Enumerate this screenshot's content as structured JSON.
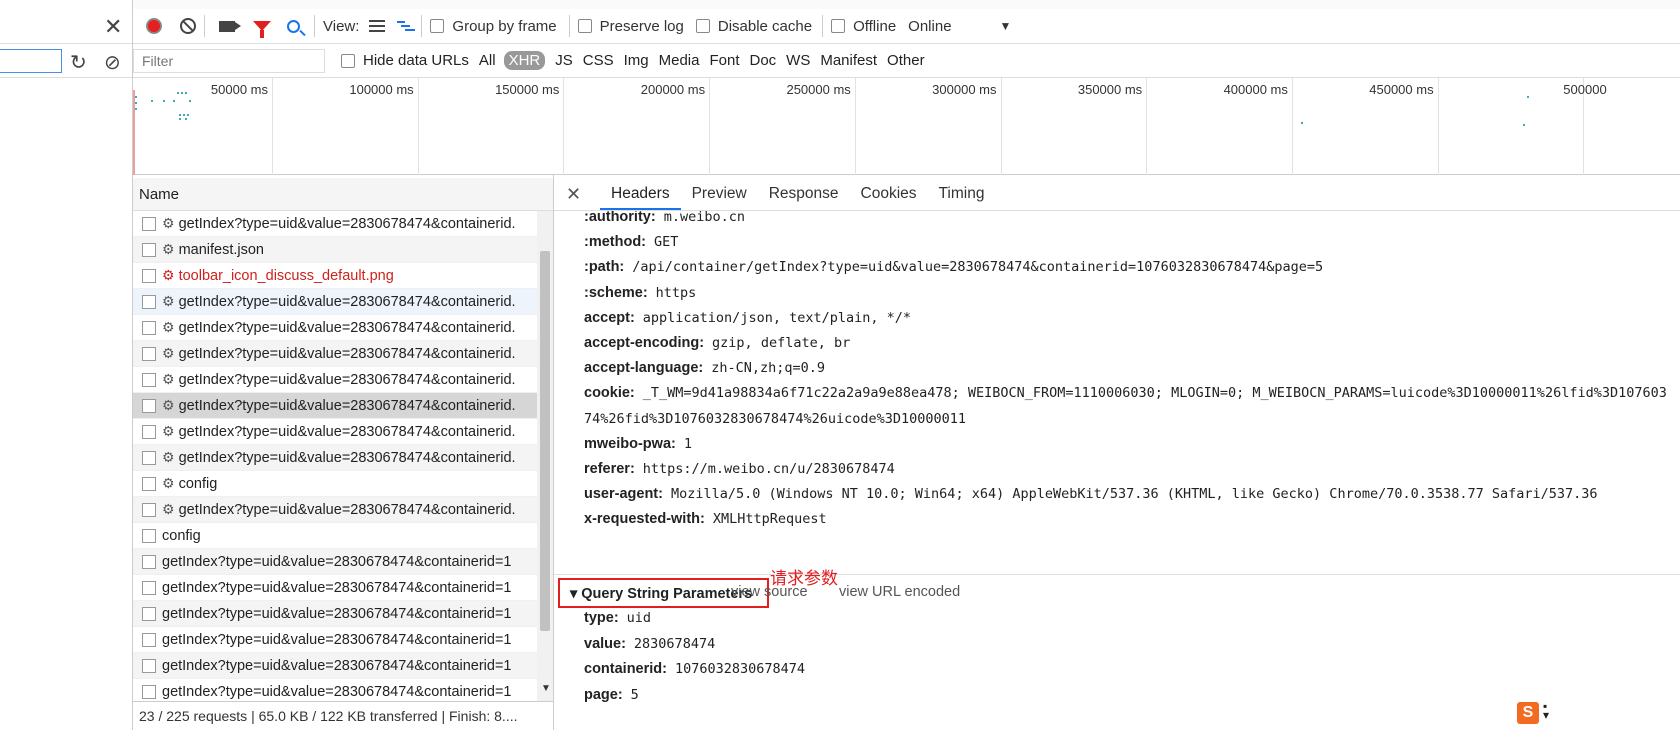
{
  "toolbar": {
    "view_label": "View:",
    "group_by_frame": "Group by frame",
    "preserve_log": "Preserve log",
    "disable_cache": "Disable cache",
    "offline": "Offline",
    "throttle": "Online"
  },
  "filterbar": {
    "placeholder": "Filter",
    "hide_data_urls": "Hide data URLs",
    "types": [
      "All",
      "XHR",
      "JS",
      "CSS",
      "Img",
      "Media",
      "Font",
      "Doc",
      "WS",
      "Manifest",
      "Other"
    ],
    "active_type": "XHR"
  },
  "overview": {
    "ticks": [
      "50000 ms",
      "100000 ms",
      "150000 ms",
      "200000 ms",
      "250000 ms",
      "300000 ms",
      "350000 ms",
      "400000 ms",
      "450000 ms",
      "500000"
    ]
  },
  "requests": {
    "header": "Name",
    "items": [
      {
        "name": "getIndex?type=uid&value=2830678474&containerid.",
        "icon": true,
        "state": "normal"
      },
      {
        "name": "manifest.json",
        "icon": true,
        "state": "alt"
      },
      {
        "name": "toolbar_icon_discuss_default.png",
        "icon": true,
        "state": "error"
      },
      {
        "name": "getIndex?type=uid&value=2830678474&containerid.",
        "icon": true,
        "state": "highlight"
      },
      {
        "name": "getIndex?type=uid&value=2830678474&containerid.",
        "icon": true,
        "state": "normal"
      },
      {
        "name": "getIndex?type=uid&value=2830678474&containerid.",
        "icon": true,
        "state": "alt"
      },
      {
        "name": "getIndex?type=uid&value=2830678474&containerid.",
        "icon": true,
        "state": "normal"
      },
      {
        "name": "getIndex?type=uid&value=2830678474&containerid.",
        "icon": true,
        "state": "selected"
      },
      {
        "name": "getIndex?type=uid&value=2830678474&containerid.",
        "icon": true,
        "state": "normal"
      },
      {
        "name": "getIndex?type=uid&value=2830678474&containerid.",
        "icon": true,
        "state": "alt"
      },
      {
        "name": "config",
        "icon": true,
        "state": "normal"
      },
      {
        "name": "getIndex?type=uid&value=2830678474&containerid.",
        "icon": true,
        "state": "alt"
      },
      {
        "name": "config",
        "icon": false,
        "state": "normal"
      },
      {
        "name": "getIndex?type=uid&value=2830678474&containerid=1",
        "icon": false,
        "state": "alt"
      },
      {
        "name": "getIndex?type=uid&value=2830678474&containerid=1",
        "icon": false,
        "state": "normal"
      },
      {
        "name": "getIndex?type=uid&value=2830678474&containerid=1",
        "icon": false,
        "state": "alt"
      },
      {
        "name": "getIndex?type=uid&value=2830678474&containerid=1",
        "icon": false,
        "state": "normal"
      },
      {
        "name": "getIndex?type=uid&value=2830678474&containerid=1",
        "icon": false,
        "state": "alt"
      },
      {
        "name": "getIndex?type=uid&value=2830678474&containerid=1",
        "icon": false,
        "state": "normal"
      }
    ],
    "status": "23 / 225 requests  |  65.0 KB / 122 KB transferred  |  Finish: 8...."
  },
  "details": {
    "tabs": [
      "Headers",
      "Preview",
      "Response",
      "Cookies",
      "Timing"
    ],
    "active_tab": "Headers",
    "headers": [
      {
        "key": ":authority:",
        "value": "m.weibo.cn"
      },
      {
        "key": ":method:",
        "value": "GET"
      },
      {
        "key": ":path:",
        "value": "/api/container/getIndex?type=uid&value=2830678474&containerid=1076032830678474&page=5"
      },
      {
        "key": ":scheme:",
        "value": "https"
      },
      {
        "key": "accept:",
        "value": "application/json, text/plain, */*"
      },
      {
        "key": "accept-encoding:",
        "value": "gzip, deflate, br"
      },
      {
        "key": "accept-language:",
        "value": "zh-CN,zh;q=0.9"
      },
      {
        "key": "cookie:",
        "value": "_T_WM=9d41a98834a6f71c22a2a9a9e88ea478; WEIBOCN_FROM=1110006030; MLOGIN=0; M_WEIBOCN_PARAMS=luicode%3D10000011%26lfid%3D107603"
      },
      {
        "key": "",
        "value": "74%26fid%3D1076032830678474%26uicode%3D10000011"
      },
      {
        "key": "mweibo-pwa:",
        "value": "1"
      },
      {
        "key": "referer:",
        "value": "https://m.weibo.cn/u/2830678474"
      },
      {
        "key": "user-agent:",
        "value": "Mozilla/5.0 (Windows NT 10.0; Win64; x64) AppleWebKit/537.36 (KHTML, like Gecko) Chrome/70.0.3538.77 Safari/537.36"
      },
      {
        "key": "x-requested-with:",
        "value": "XMLHttpRequest"
      }
    ],
    "query_section_title": "Query String Parameters",
    "view_source": "view source",
    "view_url_encoded": "view URL encoded",
    "annotation": "请求参数",
    "query_params": [
      {
        "key": "type:",
        "value": "uid"
      },
      {
        "key": "value:",
        "value": "2830678474"
      },
      {
        "key": "containerid:",
        "value": "1076032830678474"
      },
      {
        "key": "page:",
        "value": "5"
      }
    ]
  },
  "colors": {
    "record": "#e81f1f",
    "filter_icon": "#e02020",
    "accent": "#1a73e8",
    "annotation": "#e02020"
  },
  "sogou": {
    "label": "S"
  }
}
